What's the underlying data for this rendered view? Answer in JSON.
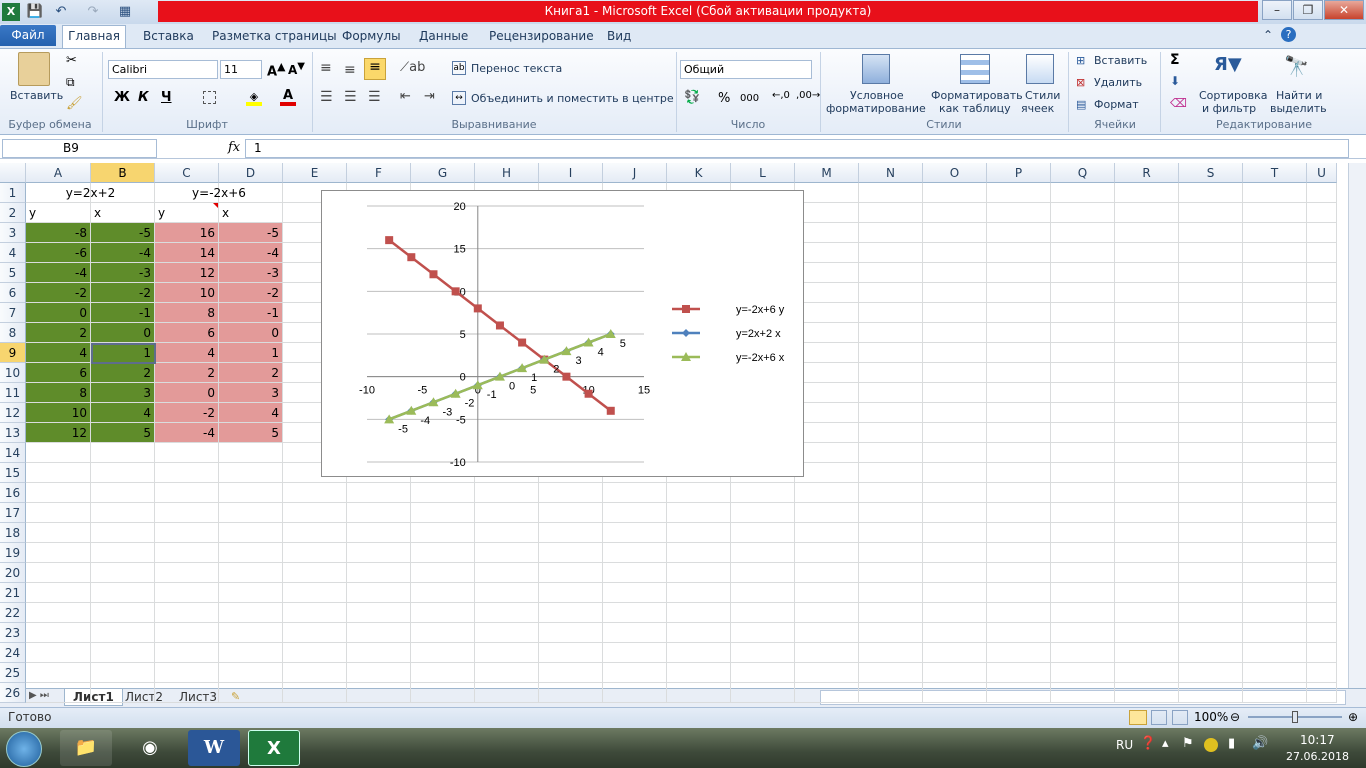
{
  "window": {
    "title": "Книга1  -  Microsoft Excel (Сбой активации продукта)",
    "min": "–",
    "max": "❐",
    "close": "✕"
  },
  "qat": {
    "save": "💾",
    "undo": "↶",
    "redo": "↷",
    "extra": "▦"
  },
  "tabs": {
    "file": "Файл",
    "home": "Главная",
    "insert": "Вставка",
    "layout": "Разметка страницы",
    "formulas": "Формулы",
    "data": "Данные",
    "review": "Рецензирование",
    "view": "Вид"
  },
  "ribbon": {
    "clipboard": {
      "paste": "Вставить",
      "label": "Буфер обмена"
    },
    "font": {
      "name": "Calibri",
      "size": "11",
      "bold": "Ж",
      "italic": "К",
      "underline": "Ч",
      "label": "Шрифт"
    },
    "align": {
      "wrap": "Перенос текста",
      "merge": "Объединить и поместить в центре",
      "label": "Выравнивание"
    },
    "number": {
      "format": "Общий",
      "percent": "%",
      "thousands": "000",
      "label": "Число"
    },
    "styles": {
      "cond": "Условное",
      "cond2": "форматирование",
      "table": "Форматировать",
      "table2": "как таблицу",
      "cell": "Стили",
      "cell2": "ячеек",
      "label": "Стили"
    },
    "cells": {
      "insert": "Вставить",
      "delete": "Удалить",
      "format": "Формат",
      "label": "Ячейки"
    },
    "edit": {
      "sort": "Сортировка",
      "sort2": "и фильтр",
      "find": "Найти и",
      "find2": "выделить",
      "label": "Редактирование"
    }
  },
  "formula": {
    "namebox": "B9",
    "fx": "fx",
    "value": "1"
  },
  "columns": [
    "A",
    "B",
    "C",
    "D",
    "E",
    "F",
    "G",
    "H",
    "I",
    "J",
    "K",
    "L",
    "M",
    "N",
    "O",
    "P",
    "Q",
    "R",
    "S",
    "T",
    "U"
  ],
  "rows": [
    "1",
    "2",
    "3",
    "4",
    "5",
    "6",
    "7",
    "8",
    "9",
    "10",
    "11",
    "12",
    "13",
    "14",
    "15",
    "16",
    "17",
    "18",
    "19",
    "20",
    "21",
    "22",
    "23",
    "24",
    "25",
    "26"
  ],
  "header1": {
    "ab": "y=2x+2",
    "cd": "y=-2x+6"
  },
  "header2": {
    "a": "y",
    "b": "x",
    "c": "y",
    "d": "x"
  },
  "table": {
    "A": [
      "-8",
      "-6",
      "-4",
      "-2",
      "0",
      "2",
      "4",
      "6",
      "8",
      "10",
      "12"
    ],
    "B": [
      "-5",
      "-4",
      "-3",
      "-2",
      "-1",
      "0",
      "1",
      "2",
      "3",
      "4",
      "5"
    ],
    "C": [
      "16",
      "14",
      "12",
      "10",
      "8",
      "6",
      "4",
      "2",
      "0",
      "-2",
      "-4"
    ],
    "D": [
      "-5",
      "-4",
      "-3",
      "-2",
      "-1",
      "0",
      "1",
      "2",
      "3",
      "4",
      "5"
    ]
  },
  "chart_data": {
    "type": "scatter",
    "xlim": [
      -10,
      15
    ],
    "ylim": [
      -10,
      20
    ],
    "xticks": [
      "-10",
      "-5",
      "0",
      "5",
      "10",
      "15"
    ],
    "yticks": [
      "20",
      "15",
      "10",
      "5",
      "0",
      "-5",
      "-10"
    ],
    "series": [
      {
        "name": "y=-2x+6  y",
        "color": "#c0504d",
        "marker": "square",
        "x": [
          -8,
          -6,
          -4,
          -2,
          0,
          2,
          4,
          6,
          8,
          10,
          12
        ],
        "y": [
          16,
          14,
          12,
          10,
          8,
          6,
          4,
          2,
          0,
          -2,
          -4
        ]
      },
      {
        "name": "y=2x+2  x",
        "color": "#4f81bd",
        "marker": "diamond",
        "x": [
          -8,
          -6,
          -4,
          -2,
          0,
          2,
          4,
          6,
          8,
          10,
          12
        ],
        "y": [
          -5,
          -4,
          -3,
          -2,
          -1,
          0,
          1,
          2,
          3,
          4,
          5
        ]
      },
      {
        "name": "y=-2x+6  x",
        "color": "#9bbb59",
        "marker": "triangle",
        "x": [
          -8,
          -6,
          -4,
          -2,
          0,
          2,
          4,
          6,
          8,
          10,
          12
        ],
        "y": [
          -5,
          -4,
          -3,
          -2,
          -1,
          0,
          1,
          2,
          3,
          4,
          5
        ],
        "labels": [
          "-5",
          "-4",
          "-3",
          "-2",
          "-1",
          "0",
          "1",
          "2",
          "3",
          "4",
          "5"
        ]
      }
    ],
    "grid": true,
    "legend": "right"
  },
  "sheets": {
    "s1": "Лист1",
    "s2": "Лист2",
    "s3": "Лист3"
  },
  "status": {
    "ready": "Готово",
    "zoom": "100%"
  },
  "taskbar": {
    "lang": "RU",
    "time": "10:17",
    "date": "27.06.2018"
  }
}
